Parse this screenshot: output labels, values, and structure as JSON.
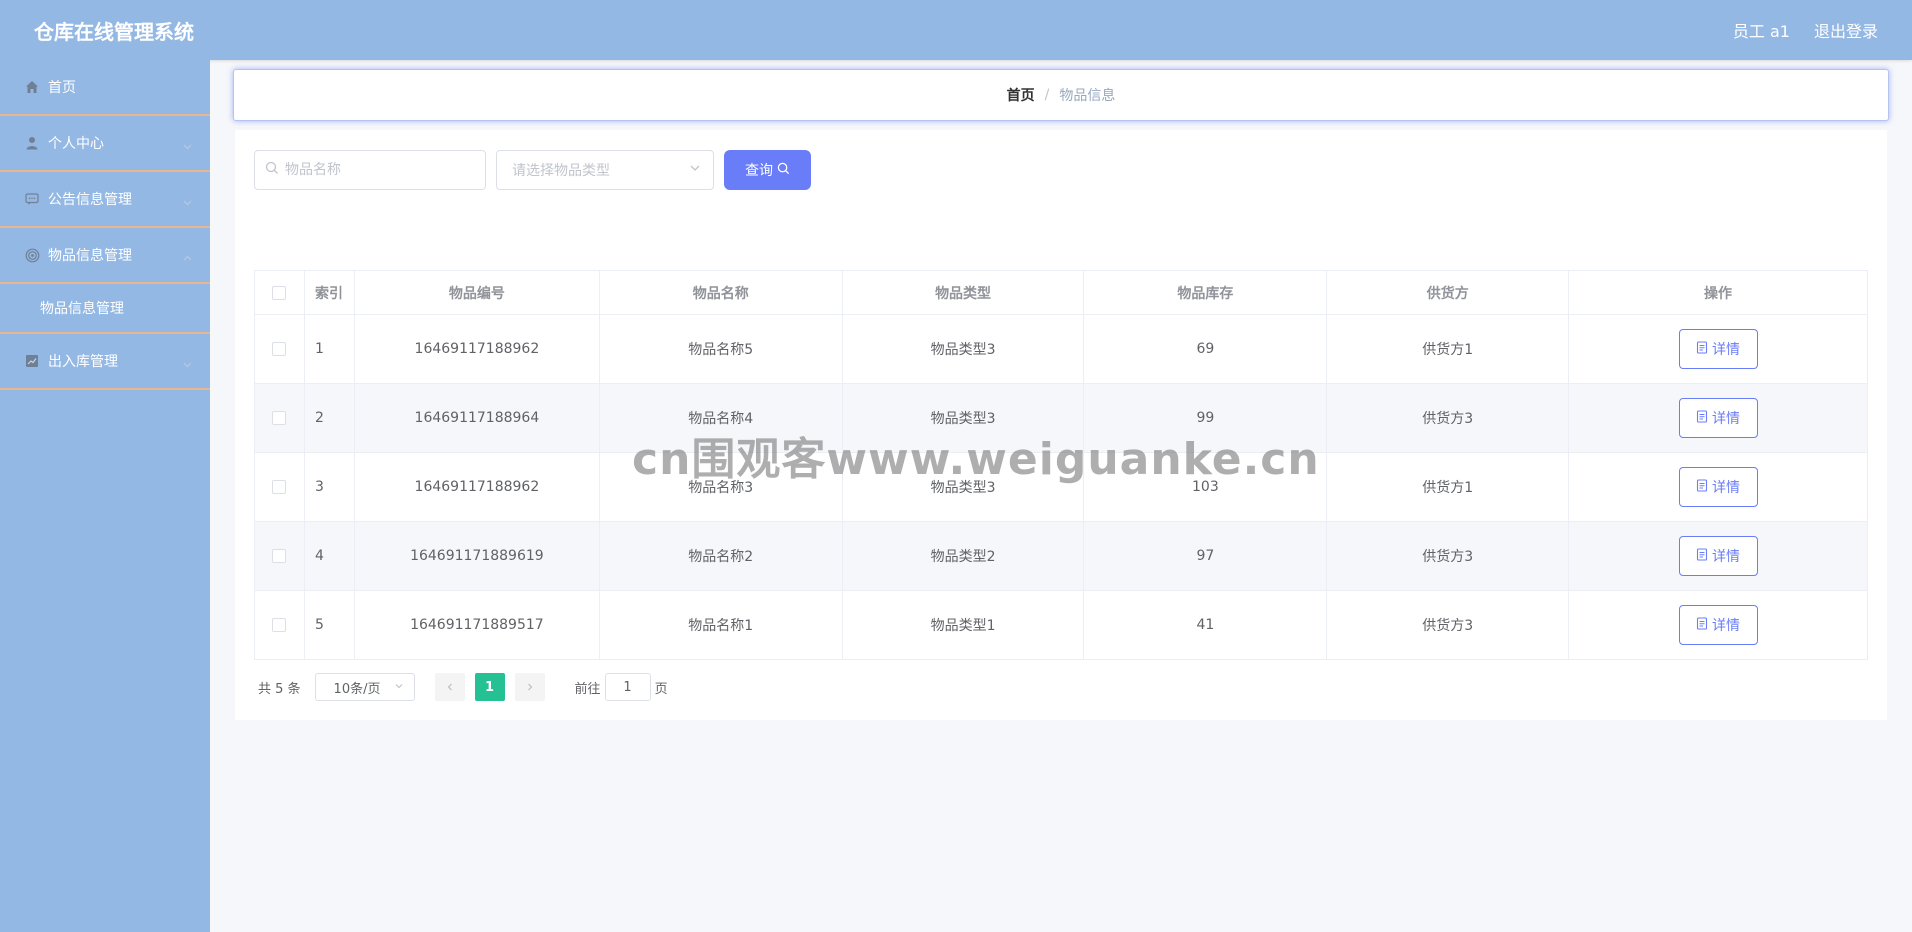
{
  "header": {
    "title": "仓库在线管理系统",
    "user_label": "员工 a1",
    "logout_label": "退出登录"
  },
  "sidebar": {
    "items": [
      {
        "label": "首页",
        "icon": "home-icon"
      },
      {
        "label": "个人中心",
        "icon": "user-icon"
      },
      {
        "label": "公告信息管理",
        "icon": "chat-icon"
      },
      {
        "label": "物品信息管理",
        "icon": "target-icon"
      },
      {
        "label": "出入库管理",
        "icon": "chart-icon"
      }
    ],
    "sub_item": "物品信息管理"
  },
  "breadcrumb": {
    "home": "首页",
    "separator": "/",
    "current": "物品信息"
  },
  "search": {
    "name_placeholder": "物品名称",
    "type_placeholder": "请选择物品类型",
    "query_label": "查询"
  },
  "table": {
    "columns": [
      "索引",
      "物品编号",
      "物品名称",
      "物品类型",
      "物品库存",
      "供货方",
      "操作"
    ],
    "rows": [
      {
        "index": "1",
        "code": "16469117188962",
        "name": "物品名称5",
        "type": "物品类型3",
        "stock": "69",
        "supplier": "供货方1"
      },
      {
        "index": "2",
        "code": "16469117188964",
        "name": "物品名称4",
        "type": "物品类型3",
        "stock": "99",
        "supplier": "供货方3"
      },
      {
        "index": "3",
        "code": "16469117188962",
        "name": "物品名称3",
        "type": "物品类型3",
        "stock": "103",
        "supplier": "供货方1"
      },
      {
        "index": "4",
        "code": "164691171889619",
        "name": "物品名称2",
        "type": "物品类型2",
        "stock": "97",
        "supplier": "供货方3"
      },
      {
        "index": "5",
        "code": "164691171889517",
        "name": "物品名称1",
        "type": "物品类型1",
        "stock": "41",
        "supplier": "供货方3"
      }
    ],
    "detail_label": "详情"
  },
  "pagination": {
    "total": "共 5 条",
    "page_size": "10条/页",
    "current_page": "1",
    "goto_label": "前往",
    "goto_value": "1",
    "page_suffix": "页"
  },
  "watermark": "cn围观客www.weiguanke.cn",
  "colors": {
    "header_bg": "#94b8e4",
    "accent": "#6a7df8",
    "active_page": "#25c195",
    "sidebar_divider": "#e7b78f"
  }
}
